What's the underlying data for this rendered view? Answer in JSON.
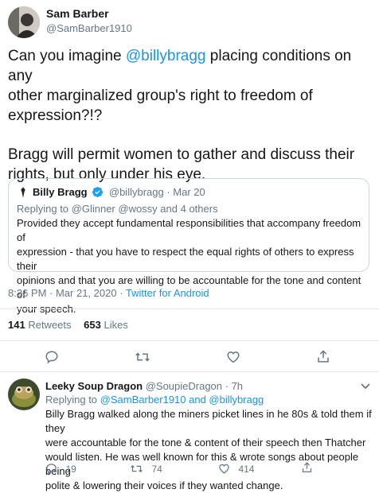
{
  "main_tweet": {
    "author_name": "Sam Barber",
    "author_handle": "@SamBarber1910",
    "text_1_prefix": "Can you imagine ",
    "text_1_mention": "@billybragg",
    "text_1_suffix": " placing conditions on any",
    "text_2": "other marginalized group's right to freedom of",
    "text_3": "expression?!?",
    "text_4": "Bragg will permit women to gather and discuss their",
    "text_5": "rights, but only under his eye.",
    "timestamp": "8:26 PM · Mar 21, 2020 · ",
    "source": "Twitter for Android",
    "retweets_count": "141",
    "retweets_label": "Retweets",
    "likes_count": "653",
    "likes_label": "Likes"
  },
  "quoted_tweet": {
    "author_name": "Billy Bragg",
    "verified_badge": "verified-badge-icon",
    "author_handle": "@billybragg · Mar 20",
    "reply_prefix": "Replying to ",
    "reply_targets": "@Glinner @wossy and 4 others",
    "text_1": "Provided they accept fundamental responsibilities that accompany freedom of",
    "text_2": "expression - that you have to respect the equal rights of others to express their",
    "text_3": "opinions and that you are willing to be accountable for the tone and content of",
    "text_4": "your speech."
  },
  "reply_tweet": {
    "author_name": "Leeky Soup Dragon",
    "author_handle": "@SoupieDragon · 7h",
    "reply_prefix": "Replying to ",
    "reply_targets": "@SamBarber1910 and @billybragg",
    "text_1": "Billy Bragg walked along the miners picket lines in he 80s & told them if they",
    "text_2": "were accountable for the tone & content of their speech then Thatcher",
    "text_3": "would listen. He was well known for this & wrote songs about people being",
    "text_4": "polite & lowering their voices if they wanted change.",
    "reply_count": "19",
    "retweet_count": "74",
    "like_count": "414"
  },
  "colors": {
    "link": "#1b95e0",
    "muted": "#657786",
    "text": "#14171a",
    "border": "#e6ecf0"
  },
  "icons": [
    "reply-icon",
    "retweet-icon",
    "like-icon",
    "share-icon",
    "verified-badge-icon"
  ]
}
